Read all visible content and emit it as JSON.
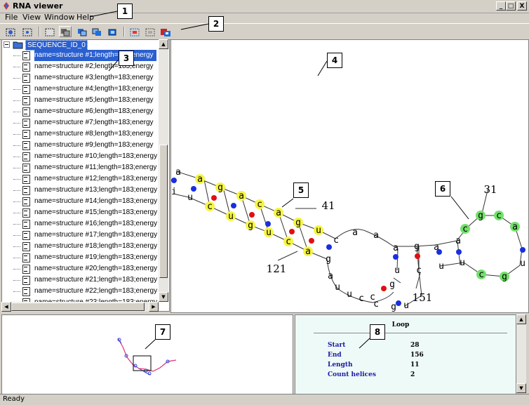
{
  "window": {
    "title": "RNA viewer",
    "minimize": "_",
    "maximize": "□",
    "close": "X"
  },
  "menu": [
    "File",
    "View",
    "Window",
    "Help"
  ],
  "tree": {
    "root": "SEQUENCE_ID_0",
    "items": [
      "name=structure #1;length=183;energy",
      "name=structure #2;length=183;energy",
      "name=structure #3;length=183;energy",
      "name=structure #4;length=183;energy",
      "name=structure #5;length=183;energy",
      "name=structure #6;length=183;energy",
      "name=structure #7;length=183;energy",
      "name=structure #8;length=183;energy",
      "name=structure #9;length=183;energy",
      "name=structure #10;length=183;energy",
      "name=structure #11;length=183;energy",
      "name=structure #12;length=183;energy",
      "name=structure #13;length=183;energy",
      "name=structure #14;length=183;energy",
      "name=structure #15;length=183;energy",
      "name=structure #16;length=183;energy",
      "name=structure #17;length=183;energy",
      "name=structure #18;length=183;energy",
      "name=structure #19;length=183;energy",
      "name=structure #20;length=183;energy",
      "name=structure #21;length=183;energy",
      "name=structure #22;length=183;energy",
      "name=structure #23;length=183;energy"
    ],
    "selected_index": 0
  },
  "structure": {
    "position_labels": [
      "41",
      "121",
      "31",
      "151"
    ],
    "highlight_colors": {
      "helix": "#f5f542",
      "loop": "#72e06a",
      "gc_pair": "#e01010",
      "au_pair": "#1a2ee0"
    }
  },
  "info": {
    "header": "Loop",
    "rows": [
      {
        "key": "Start",
        "value": "28"
      },
      {
        "key": "End",
        "value": "156"
      },
      {
        "key": "Length",
        "value": "11"
      },
      {
        "key": "Count helices",
        "value": "2"
      }
    ]
  },
  "callouts": [
    "1",
    "2",
    "3",
    "4",
    "5",
    "6",
    "7",
    "8"
  ],
  "status": "Ready"
}
